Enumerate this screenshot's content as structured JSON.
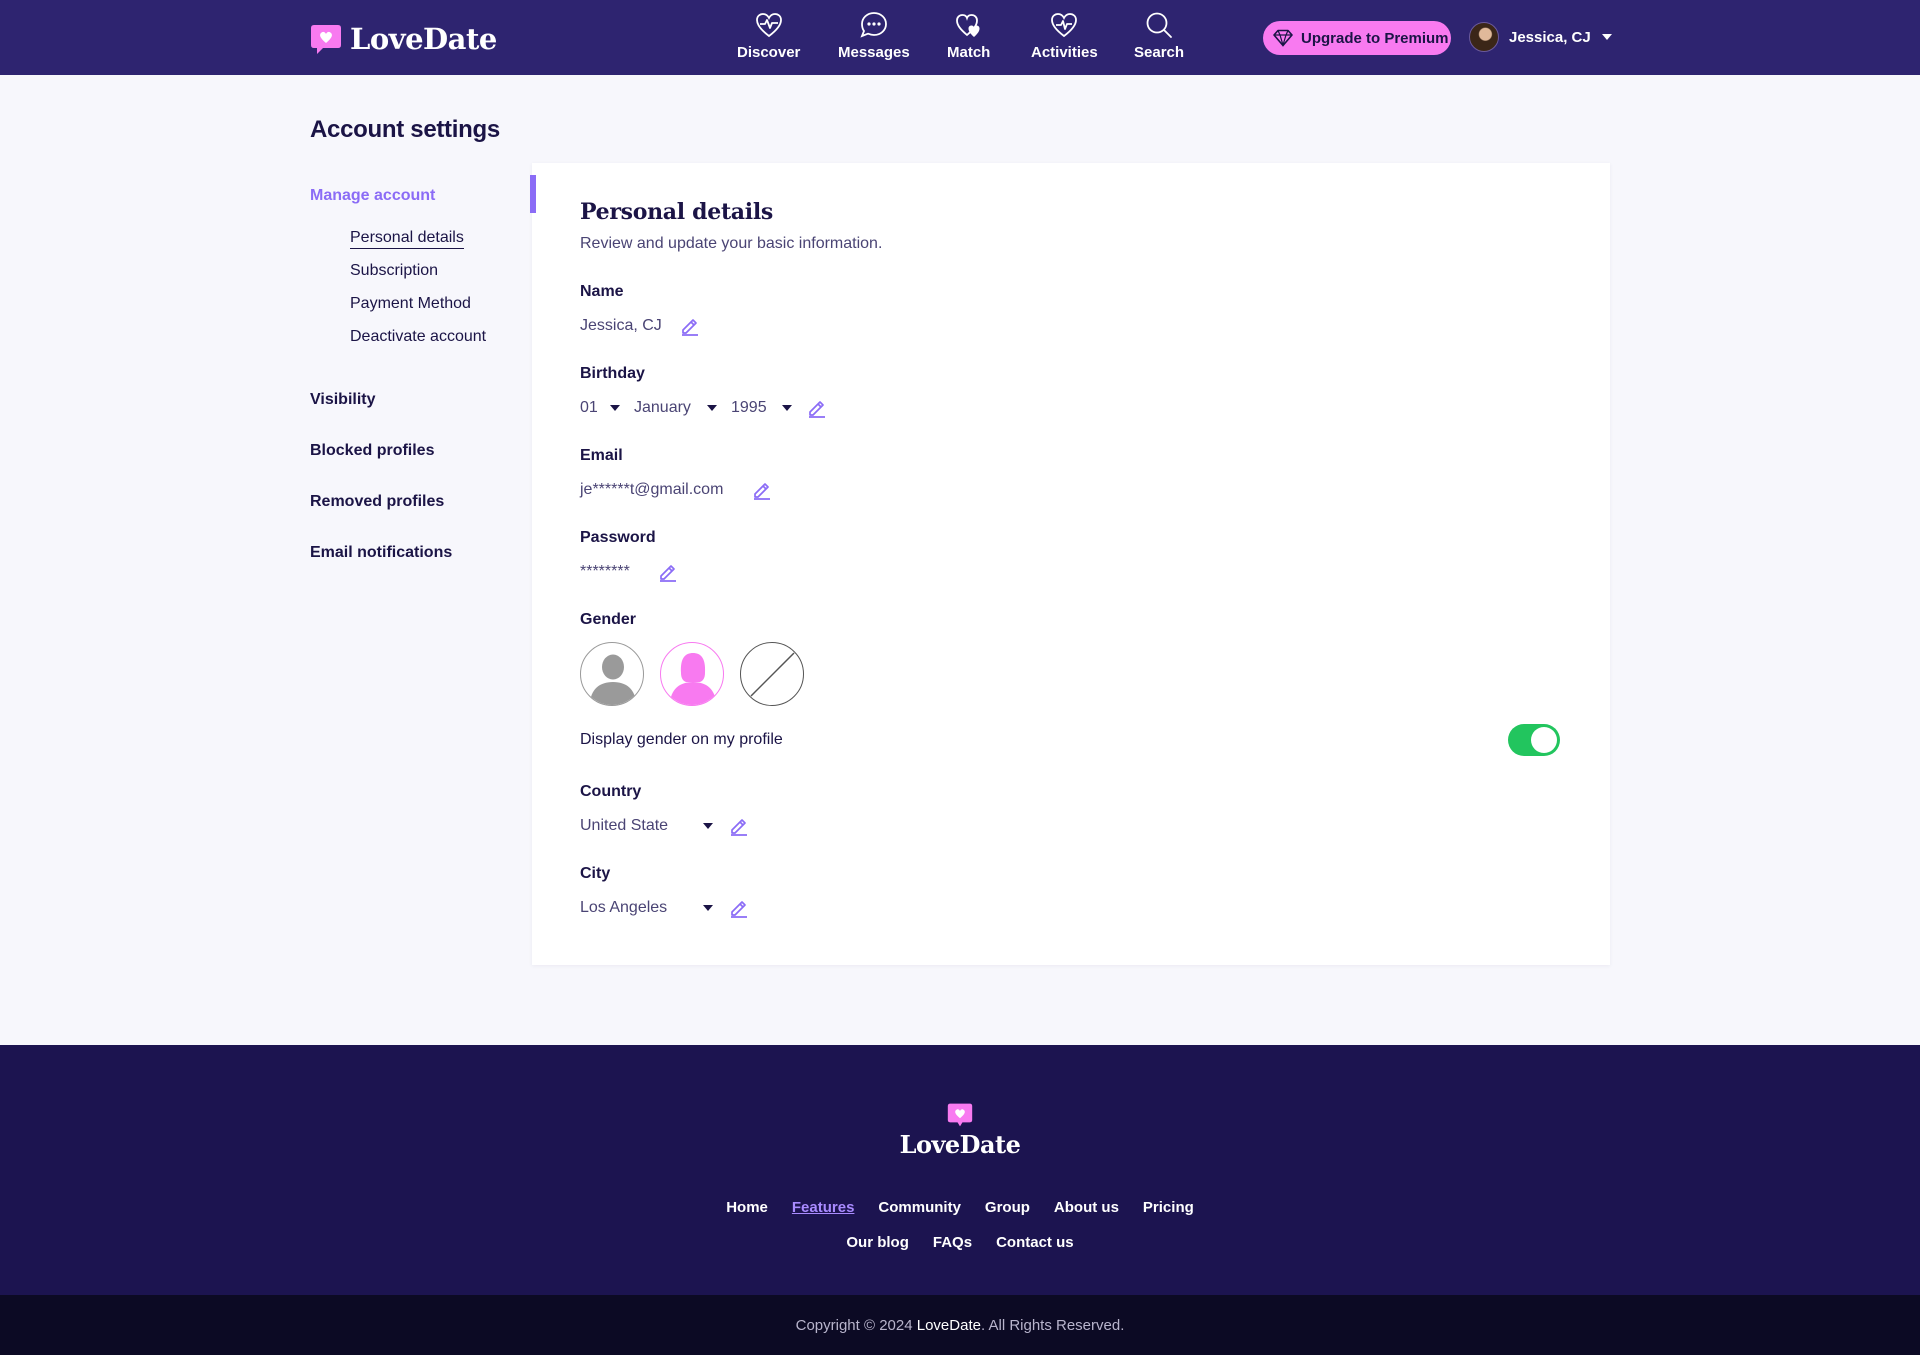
{
  "header": {
    "brand": "LoveDate",
    "nav": [
      {
        "label": "Discover",
        "icon": "heart-pulse-icon"
      },
      {
        "label": "Messages",
        "icon": "chat-bubble-icon"
      },
      {
        "label": "Match",
        "icon": "hearts-icon"
      },
      {
        "label": "Activities",
        "icon": "heart-activity-icon"
      },
      {
        "label": "Search",
        "icon": "search-icon"
      }
    ],
    "upgrade_label": "Upgrade to Premium",
    "user_name": "Jessica, CJ"
  },
  "page": {
    "title": "Account settings"
  },
  "sidebar": {
    "manage_account": "Manage account",
    "manage_items": [
      "Personal details",
      "Subscription",
      "Payment Method",
      "Deactivate account"
    ],
    "groups": [
      "Visibility",
      "Blocked profiles",
      "Removed profiles",
      "Email notifications"
    ]
  },
  "details": {
    "title": "Personal details",
    "subtitle": "Review and update your basic information.",
    "name_label": "Name",
    "name_value": "Jessica, CJ",
    "birthday_label": "Birthday",
    "birthday_day": "01",
    "birthday_month": "January",
    "birthday_year": "1995",
    "email_label": "Email",
    "email_value": "je******t@gmail.com",
    "password_label": "Password",
    "password_value": "********",
    "gender_label": "Gender",
    "gender_options": [
      "male",
      "female",
      "none"
    ],
    "gender_selected": "female",
    "display_gender_label": "Display gender on my profile",
    "display_gender_on": true,
    "country_label": "Country",
    "country_value": "United State",
    "city_label": "City",
    "city_value": "Los Angeles"
  },
  "footer": {
    "brand": "LoveDate",
    "links_row1": [
      "Home",
      "Features",
      "Community",
      "Group",
      "About us",
      "Pricing"
    ],
    "links_row2": [
      "Our blog",
      "FAQs",
      "Contact us"
    ],
    "active_link": "Features",
    "copyright_prefix": "Copyright © 2024",
    "copyright_brand": "LoveDate",
    "copyright_suffix": ". All Rights Reserved."
  },
  "colors": {
    "header_bg": "#2e2470",
    "accent": "#8b6cf6",
    "pink": "#f87af0",
    "toggle_on": "#22c55e",
    "footer_bg": "#1c1450"
  }
}
